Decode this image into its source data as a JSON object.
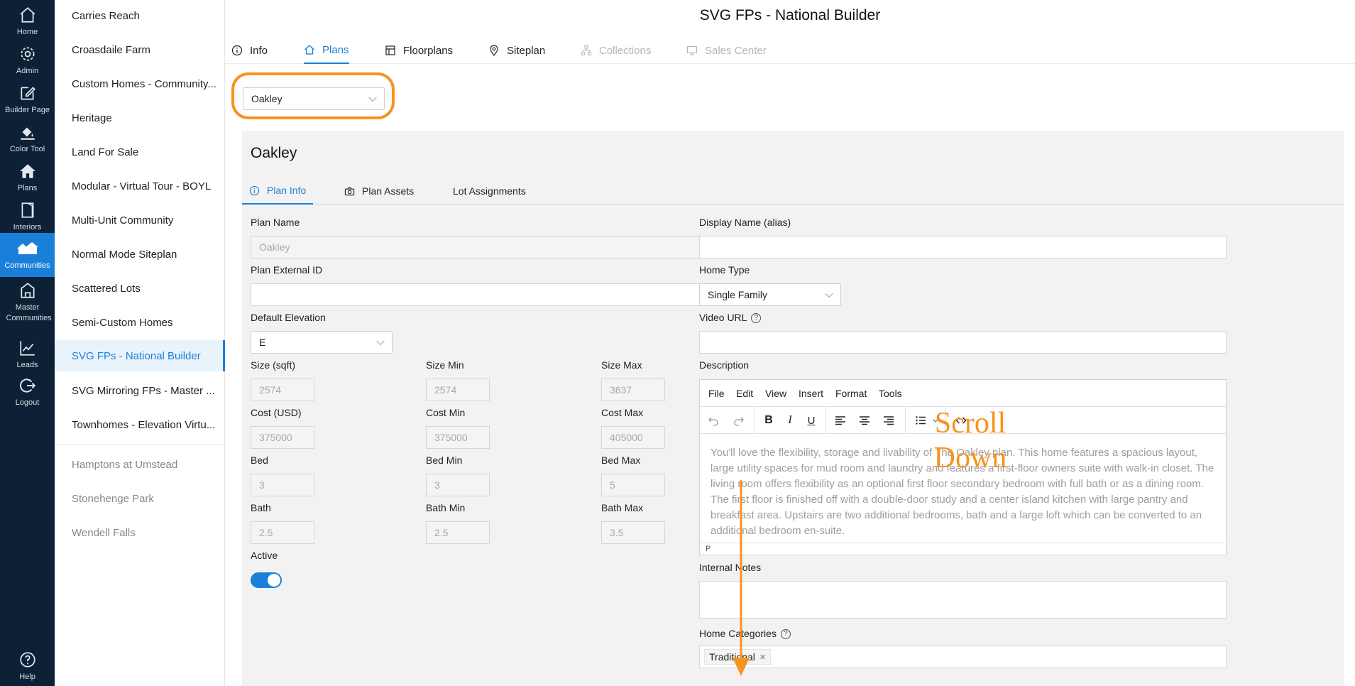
{
  "nav": [
    {
      "label": "Home",
      "icon": "home-icon"
    },
    {
      "label": "Admin",
      "icon": "gear-icon"
    },
    {
      "label": "Builder Page",
      "icon": "edit-icon"
    },
    {
      "label": "Color Tool",
      "icon": "paint-bucket-icon"
    },
    {
      "label": "Plans",
      "icon": "house-icon"
    },
    {
      "label": "Interiors",
      "icon": "door-icon"
    },
    {
      "label": "Communities",
      "icon": "houses-icon"
    },
    {
      "label": "Master Communities",
      "icon": "castle-icon"
    },
    {
      "label": "Leads",
      "icon": "chart-icon"
    },
    {
      "label": "Logout",
      "icon": "logout-icon"
    },
    {
      "label": "Help",
      "icon": "help-icon"
    }
  ],
  "communities": [
    "Carries Reach",
    "Croasdaile Farm",
    "Custom Homes - Community...",
    "Heritage",
    "Land For Sale",
    "Modular - Virtual Tour - BOYL",
    "Multi-Unit Community",
    "Normal Mode Siteplan",
    "Scattered Lots",
    "Semi-Custom Homes",
    "SVG FPs - National Builder",
    "SVG Mirroring FPs - Master ...",
    "Townhomes - Elevation Virtu..."
  ],
  "other_communities": [
    "Hamptons at Umstead",
    "Stonehenge Park",
    "Wendell Falls"
  ],
  "page_title": "SVG FPs - National Builder",
  "tabs": [
    "Info",
    "Plans",
    "Floorplans",
    "Siteplan",
    "Collections",
    "Sales Center"
  ],
  "plan_select": "Oakley",
  "panel_title": "Oakley",
  "subtabs": [
    "Plan Info",
    "Plan Assets",
    "Lot Assignments"
  ],
  "form": {
    "plan_name_label": "Plan Name",
    "plan_name": "Oakley",
    "plan_external_id_label": "Plan External ID",
    "default_elevation_label": "Default Elevation",
    "default_elevation": "E",
    "size_label": "Size (sqft)",
    "size": "2574",
    "size_min_label": "Size Min",
    "size_min": "2574",
    "size_max_label": "Size Max",
    "size_max": "3637",
    "cost_label": "Cost (USD)",
    "cost": "375000",
    "cost_min_label": "Cost Min",
    "cost_min": "375000",
    "cost_max_label": "Cost Max",
    "cost_max": "405000",
    "bed_label": "Bed",
    "bed": "3",
    "bed_min_label": "Bed Min",
    "bed_min": "3",
    "bed_max_label": "Bed Max",
    "bed_max": "5",
    "bath_label": "Bath",
    "bath": "2.5",
    "bath_min_label": "Bath Min",
    "bath_min": "2.5",
    "bath_max_label": "Bath Max",
    "bath_max": "3.5",
    "active_label": "Active",
    "display_name_label": "Display Name (alias)",
    "home_type_label": "Home Type",
    "home_type": "Single Family",
    "video_url_label": "Video URL",
    "description_label": "Description",
    "internal_notes_label": "Internal Notes",
    "home_categories_label": "Home Categories",
    "home_category_tag": "Traditional"
  },
  "editor": {
    "menu": [
      "File",
      "Edit",
      "View",
      "Insert",
      "Format",
      "Tools"
    ],
    "description": "You'll love the flexibility, storage and livability of The Oakley plan.  This home features a spacious layout, large utility spaces for mud room and laundry and features a first-floor owners suite with walk-in closet.  The living room offers flexibility as an optional first floor secondary bedroom with full bath or as a dining room. The first floor is finished off with a double-door study and a center island kitchen with large pantry and breakfast area.  Upstairs are two additional bedrooms, bath and a large loft which can be converted to an additional bedroom en-suite.",
    "status": "P"
  },
  "annotation": {
    "line1": "Scroll",
    "line2": "Down"
  },
  "colors": {
    "accent": "#1a7fd8",
    "nav_bg": "#0c2136",
    "annotation": "#f7941d"
  }
}
